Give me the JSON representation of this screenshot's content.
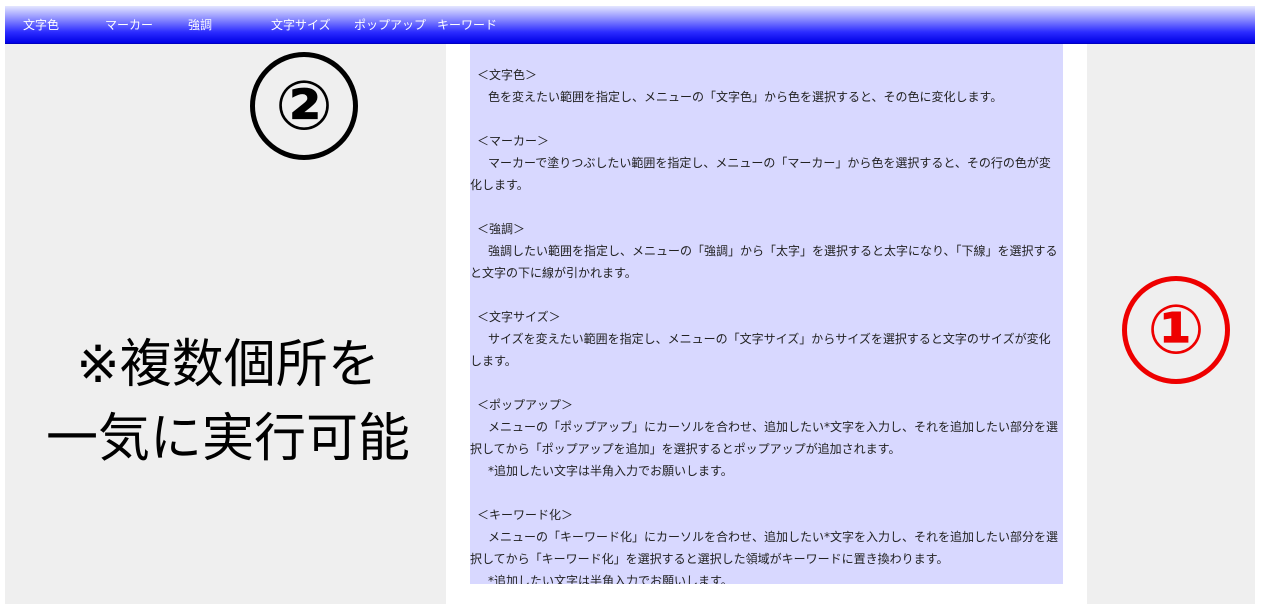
{
  "menu": {
    "items": [
      {
        "label": "文字色"
      },
      {
        "label": "マーカー"
      },
      {
        "label": "強調"
      },
      {
        "label": "文字サイズ"
      },
      {
        "label": "ポップアップ"
      },
      {
        "label": "キーワード"
      }
    ]
  },
  "content": {
    "sections": [
      {
        "heading": "＜文字色＞",
        "body": "色を変えたい範囲を指定し、メニューの「文字色」から色を選択すると、その色に変化します。"
      },
      {
        "heading": "＜マーカー＞",
        "body": "マーカーで塗りつぶしたい範囲を指定し、メニューの「マーカー」から色を選択すると、その行の色が変化します。"
      },
      {
        "heading": "＜強調＞",
        "body": "強調したい範囲を指定し、メニューの「強調」から「太字」を選択すると太字になり、「下線」を選択すると文字の下に線が引かれます。"
      },
      {
        "heading": "＜文字サイズ＞",
        "body": "サイズを変えたい範囲を指定し、メニューの「文字サイズ」からサイズを選択すると文字のサイズが変化します。"
      },
      {
        "heading": "＜ポップアップ＞",
        "body": "メニューの「ポップアップ」にカーソルを合わせ、追加したい*文字を入力し、それを追加したい部分を選択してから「ポップアップを追加」を選択するとポップアップが追加されます。",
        "note": "*追加したい文字は半角入力でお願いします。"
      },
      {
        "heading": "＜キーワード化＞",
        "body": "メニューの「キーワード化」にカーソルを合わせ、追加したい*文字を入力し、それを追加したい部分を選択してから「キーワード化」を選択すると選択した領域がキーワードに置き換わります。",
        "note": "*追加したい文字は半角入力でお願いします。"
      }
    ]
  },
  "annotations": {
    "marker_1": "①",
    "marker_2": "②",
    "marker_1_color": "#ee0000",
    "marker_2_color": "#000000",
    "note_line1": "※複数個所を",
    "note_line2": "一気に実行可能"
  },
  "colors": {
    "menubar_top": "#e4e6ff",
    "menubar_bottom": "#0000e6",
    "content_bg": "#d8d8ff",
    "side_bg": "#efefef"
  }
}
